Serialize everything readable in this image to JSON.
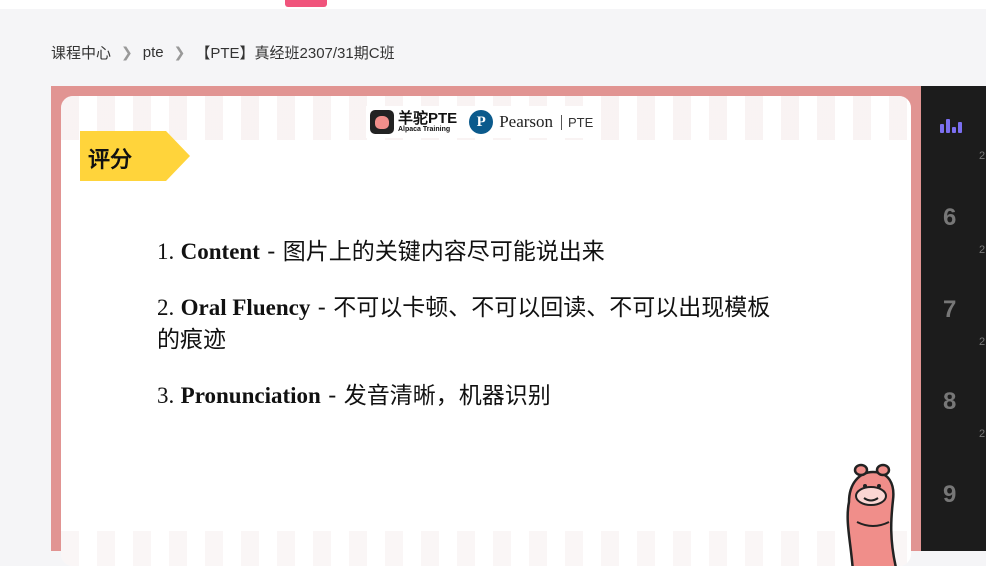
{
  "breadcrumb": {
    "items": [
      "课程中心",
      "pte",
      "【PTE】真经班2307/31期C班"
    ],
    "separator": ">"
  },
  "slide": {
    "logos": {
      "alpaca_name": "羊驼PTE",
      "alpaca_sub": "Alpaca Training",
      "pearson_name": "Pearson",
      "pearson_pte": "PTE"
    },
    "section_tag": "评分",
    "points": [
      {
        "num": "1.",
        "term": "Content",
        "desc": " - 图片上的关键内容尽可能说出来"
      },
      {
        "num": "2.",
        "term": "Oral Fluency",
        "desc": " - 不可以卡顿、不可以回读、不可以出现模板的痕迹"
      },
      {
        "num": "3.",
        "term": "Pronunciation",
        "desc": " - 发音清晰，机器识别"
      }
    ]
  },
  "sidepanel": {
    "icon": "bar-chart-icon",
    "items": [
      {
        "num": "6",
        "sub": "2"
      },
      {
        "num": "7",
        "sub": "2"
      },
      {
        "num": "8",
        "sub": "2"
      },
      {
        "num": "9",
        "sub": "2"
      }
    ]
  },
  "colors": {
    "accent": "#f0547c",
    "frame": "#e19492",
    "tag": "#ffd43b",
    "side_icon": "#7b6ff0",
    "side_bg": "#1c1c1c"
  }
}
